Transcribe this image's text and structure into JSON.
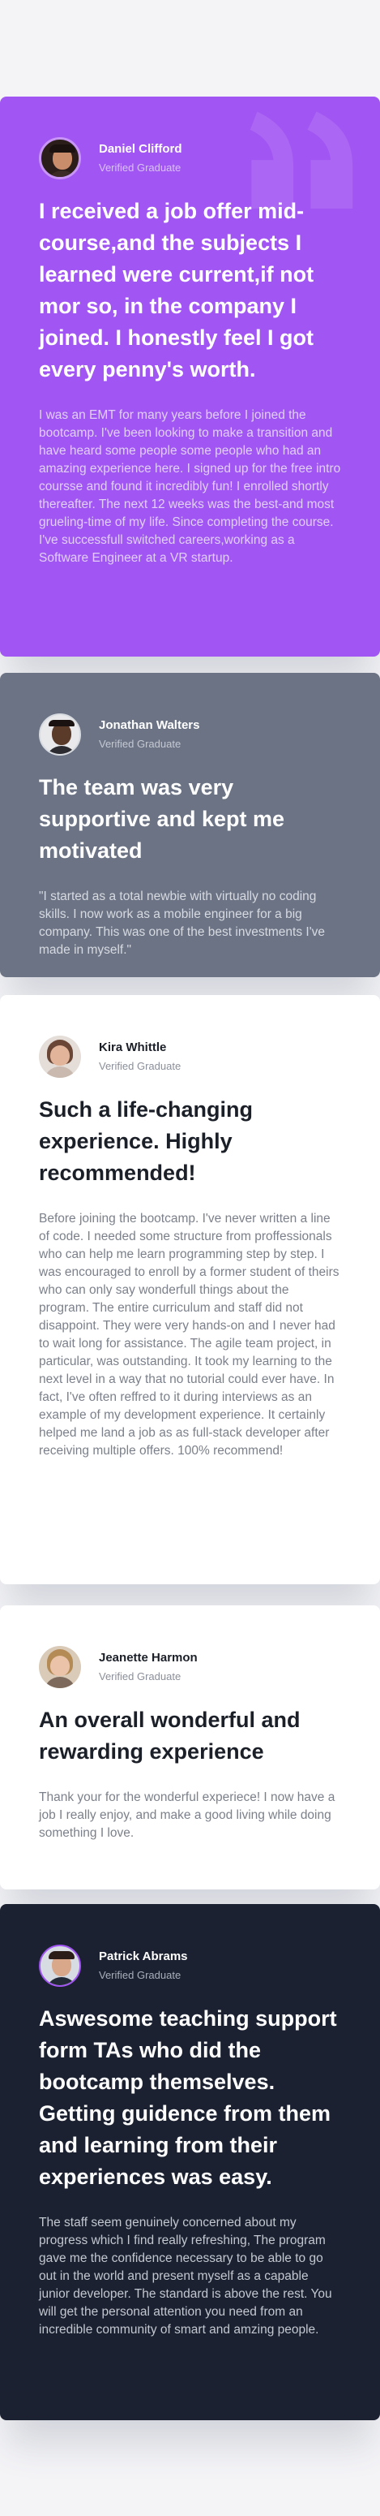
{
  "colors": {
    "violet": "#a155f2",
    "grayish_blue": "#6b7385",
    "white": "#ffffff",
    "dark_blackish_blue": "#1b2130",
    "light_grayish_blue": "#f4f4f7"
  },
  "testimonials": [
    {
      "name": "Daniel Clifford",
      "role": "Verified Graduate",
      "headline": "I received a job offer mid-course,and the subjects I learned were current,if not mor so, in the company I joined. I honestly feel I got every penny's worth.",
      "body": "I was an EMT for many years before I joined the bootcamp. I've been looking to make a transition and have heard some people some people who had an amazing experience here. I signed up for the free intro coursse and found it incredibly fun! I enrolled shortly thereafter. The next 12 weeks was the best-and most grueling-time of my life. Since completing the course. I've successfull switched careers,working as a Software Engineer at a VR startup.",
      "avatar_icon": "user-avatar",
      "quote_icon": "quotation-mark-icon",
      "background": "#a155f2"
    },
    {
      "name": "Jonathan Walters",
      "role": "Verified Graduate",
      "headline": "The team was very supportive and kept me motivated",
      "body": "\"I started as a total newbie with virtually no coding skills. I now work as a mobile engineer for a big company. This was one of the best investments I've made in myself.\"",
      "avatar_icon": "user-avatar",
      "background": "#6b7385"
    },
    {
      "name": "Kira Whittle",
      "role": "Verified Graduate",
      "headline": "Such a life-changing experience. Highly recommended!",
      "body": "Before joining the bootcamp. I've never written a line of code. I needed some structure from proffessionals who can help me learn programming step by step. I was encouraged to enroll by a former student of theirs who can only say wonderfull things about the program. The entire curriculum and staff did not disappoint. They were very hands-on and I never had to wait long for assistance. The agile team project, in particular, was outstanding. It took my learning to the next level in a way that no tutorial could ever have. In fact, I've often reffred to it during interviews as an example of my development experience. It certainly helped me land a job as as full-stack developer after receiving multiple offers. 100% recommend!",
      "avatar_icon": "user-avatar",
      "background": "#ffffff"
    },
    {
      "name": "Jeanette Harmon",
      "role": "Verified Graduate",
      "headline": "An overall wonderful and rewarding experience",
      "body": "Thank your for the wonderful experiece! I now have a job I really enjoy, and make a good living while doing something I love.",
      "avatar_icon": "user-avatar",
      "background": "#ffffff"
    },
    {
      "name": "Patrick Abrams",
      "role": "Verified Graduate",
      "headline": "Aswesome teaching support form TAs who did the bootcamp themselves. Getting guidence from them and learning from their experiences was easy.",
      "body": "The staff seem genuinely concerned about my progress which I find really refreshing, The program gave me the confidence necessary to be able to go out in the world and present myself as a capable junior developer. The standard is above the rest. You will get the personal attention you need from an incredible community of smart and amzing people.",
      "avatar_icon": "user-avatar",
      "background": "#1b2130"
    }
  ]
}
